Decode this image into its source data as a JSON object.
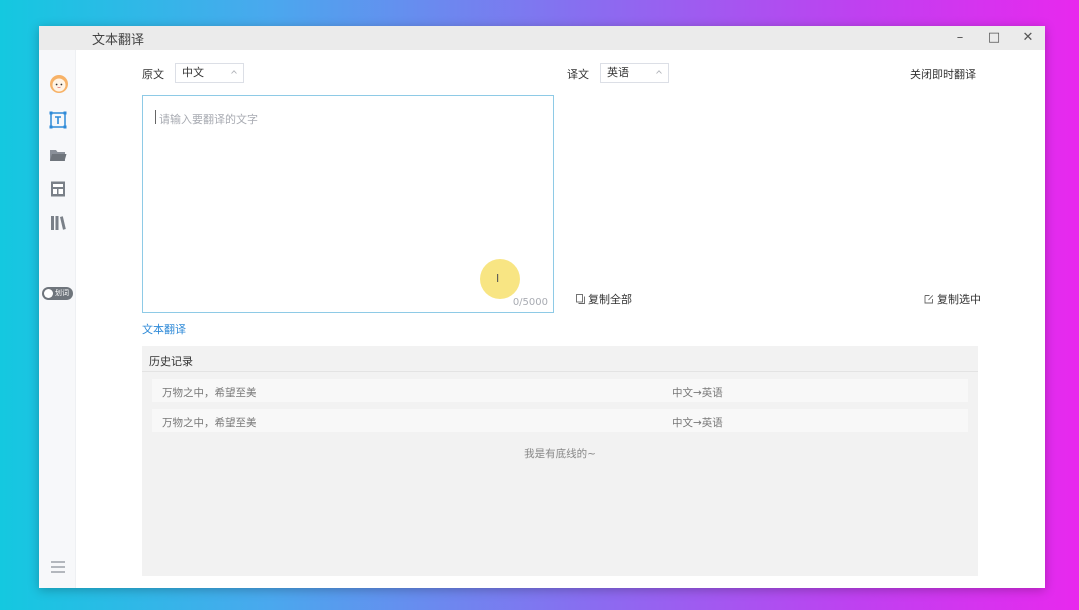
{
  "window": {
    "title": "文本翻译",
    "controls": {
      "minimize": "–",
      "maximize": "□",
      "close": "✕"
    }
  },
  "sidebar": {
    "items": [
      {
        "icon": "avatar-icon"
      },
      {
        "icon": "text-translate-icon"
      },
      {
        "icon": "folder-icon"
      },
      {
        "icon": "document-translate-icon"
      },
      {
        "icon": "library-icon"
      }
    ],
    "toggle_label": "划词"
  },
  "source": {
    "label": "原文",
    "language": "中文",
    "placeholder": "请输入要翻译的文字",
    "value": "",
    "counter": "0/5000"
  },
  "target": {
    "label": "译文",
    "language": "英语"
  },
  "instant_toggle": "关闭即时翻译",
  "actions": {
    "copy_all": "复制全部",
    "copy_selected": "复制选中"
  },
  "mode_link": "文本翻译",
  "history": {
    "title": "历史记录",
    "rows": [
      {
        "text": "万物之中，希望至美",
        "direction": "中文→英语"
      },
      {
        "text": "万物之中，希望至美",
        "direction": "中文→英语"
      }
    ],
    "end_text": "我是有底线的~"
  },
  "colors": {
    "accent": "#2e8ad8",
    "input_border": "#8ecae6",
    "cursor_highlight": "#f5dc5a"
  }
}
